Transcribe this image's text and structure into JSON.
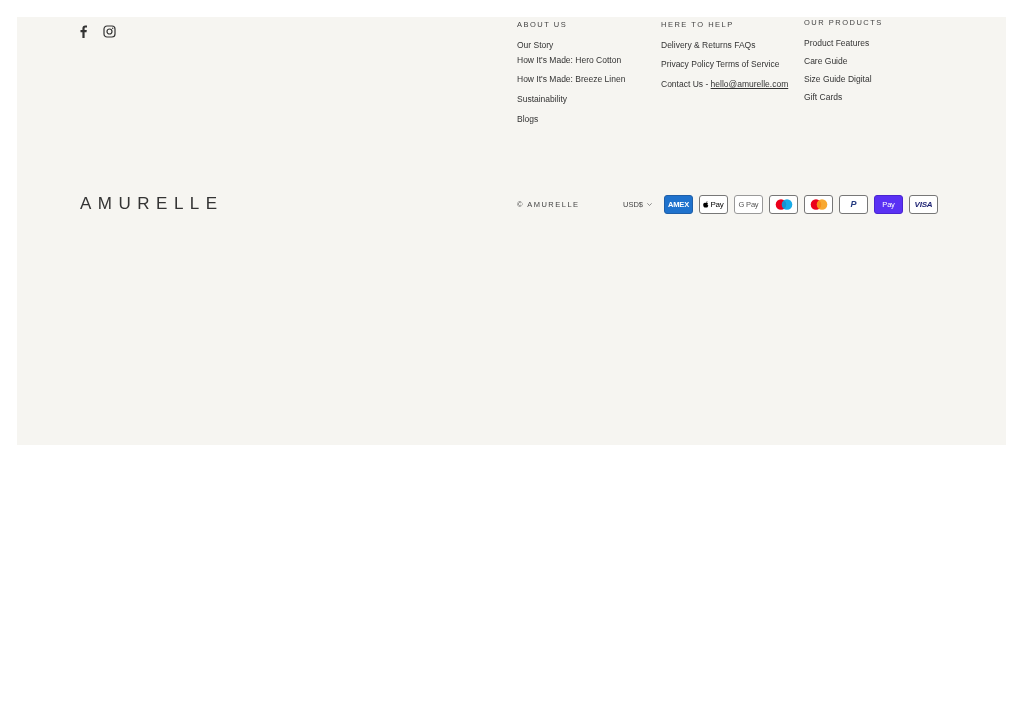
{
  "social": [
    {
      "kind": "facebook"
    },
    {
      "kind": "instagram"
    }
  ],
  "columns": [
    {
      "heading": "ABOUT US",
      "links": [
        "Our Story",
        "How It's Made: Hero Cotton",
        "How It's Made: Breeze Linen",
        "Sustainability",
        "Blogs"
      ]
    },
    {
      "heading": "HERE TO HELP",
      "links": [
        "Delivery & Returns FAQs",
        "Privacy Policy Terms of Service"
      ],
      "contact": {
        "label": "Contact Us - ",
        "email": "hello@amurelle.com"
      }
    },
    {
      "heading": "OUR PRODUCTS",
      "links": [
        "Product Features",
        "Care Guide",
        "Size Guide Digital",
        "Gift Cards"
      ]
    }
  ],
  "logo": "AMURELLE",
  "copyright": "© AMURELLE",
  "currency": "USD$",
  "payments": [
    {
      "kind": "amex",
      "label": "AMEX"
    },
    {
      "kind": "applepay",
      "label": "Pay"
    },
    {
      "kind": "googlepay",
      "label": "G Pay"
    },
    {
      "kind": "maestro"
    },
    {
      "kind": "mastercard"
    },
    {
      "kind": "paypal",
      "label": "P"
    },
    {
      "kind": "shoppay",
      "label": "Pay"
    },
    {
      "kind": "visa",
      "label": "VISA"
    }
  ]
}
